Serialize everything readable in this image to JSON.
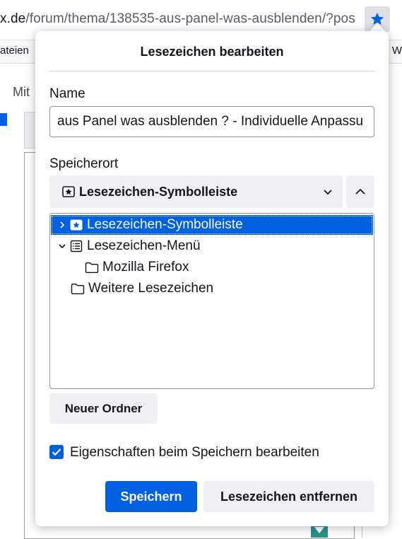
{
  "browser": {
    "url_host": "x.de",
    "url_path": "/forum/thema/138535-aus-panel-was-ausblenden/?pos",
    "bookmarks_toolbar_left": "ateien",
    "bookmarks_toolbar_right": "W",
    "page_nav_text": "Mit"
  },
  "panel": {
    "title": "Lesezeichen bearbeiten",
    "name_label": "Name",
    "name_value": "aus Panel was ausblenden ? - Individuelle Anpassu",
    "location_label": "Speicherort",
    "selected_folder": "Lesezeichen-Symbolleiste",
    "tree": [
      {
        "label": "Lesezeichen-Symbolleiste",
        "icon": "bookmarks-toolbar-icon",
        "twisty": "collapsed",
        "selected": true
      },
      {
        "label": "Lesezeichen-Menü",
        "icon": "bookmarks-menu-icon",
        "twisty": "expanded",
        "selected": false
      },
      {
        "label": "Mozilla Firefox",
        "icon": "folder-icon",
        "twisty": "none",
        "selected": false
      },
      {
        "label": "Weitere Lesezeichen",
        "icon": "folder-icon",
        "twisty": "none",
        "selected": false
      }
    ],
    "new_folder_button": "Neuer Ordner",
    "edit_on_save_label": "Eigenschaften beim Speichern bearbeiten",
    "edit_on_save_checked": true,
    "save_button": "Speichern",
    "remove_button": "Lesezeichen entfernen"
  },
  "colors": {
    "accent": "#0061e0",
    "button_bg": "#f0f0f4",
    "text": "#15141a"
  }
}
